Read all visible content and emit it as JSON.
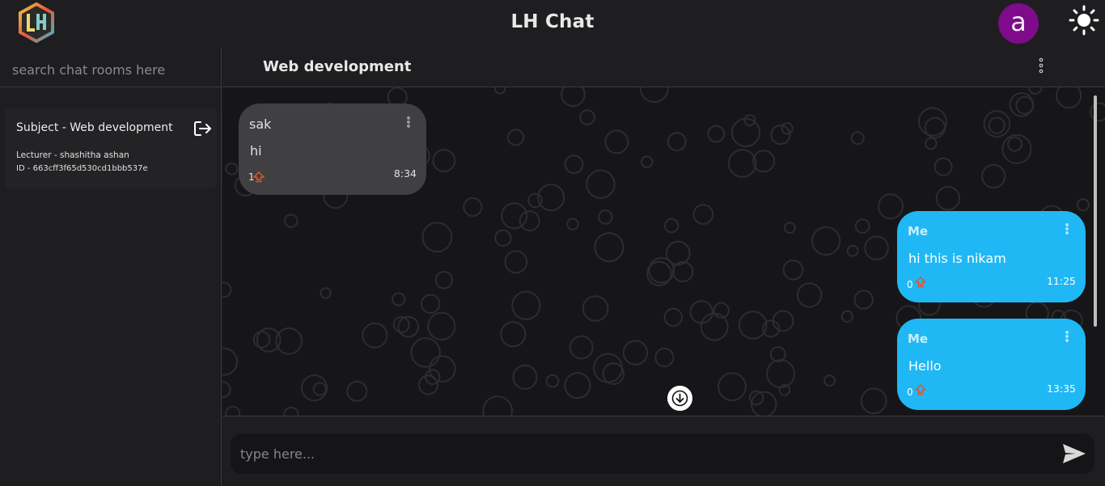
{
  "header": {
    "app_title": "LH Chat",
    "logo_text": "LH",
    "avatar_letter": "a",
    "avatar_color": "#7d0b8a",
    "theme_icon": "sun-icon"
  },
  "sidebar": {
    "search_placeholder": "search chat rooms here",
    "rooms": [
      {
        "subject": "Subject - Web development",
        "lecturer": "Lecturer - shashitha ashan",
        "id": "ID - 663cff3f65d530cd1bbb537e",
        "action_icon": "leave-icon"
      }
    ]
  },
  "chat": {
    "title": "Web development",
    "menu_icon": "vertical-dots-icon",
    "messages": [
      {
        "sender": "sak",
        "text": "hi",
        "votes": "1",
        "time": "8:34",
        "own": false
      },
      {
        "sender": "Me",
        "text": "hi this is nikam",
        "votes": "0",
        "time": "11:25",
        "own": true
      },
      {
        "sender": "Me",
        "text": "Hello",
        "votes": "0",
        "time": "13:35",
        "own": true
      }
    ],
    "scroll_down_icon": "arrow-down-icon"
  },
  "composer": {
    "placeholder": "type here...",
    "send_icon": "send-icon"
  },
  "colors": {
    "background": "#1c1c1e",
    "own_bubble": "#1fb8f5",
    "other_bubble": "#404043",
    "vote_icon": "#e0542a"
  }
}
